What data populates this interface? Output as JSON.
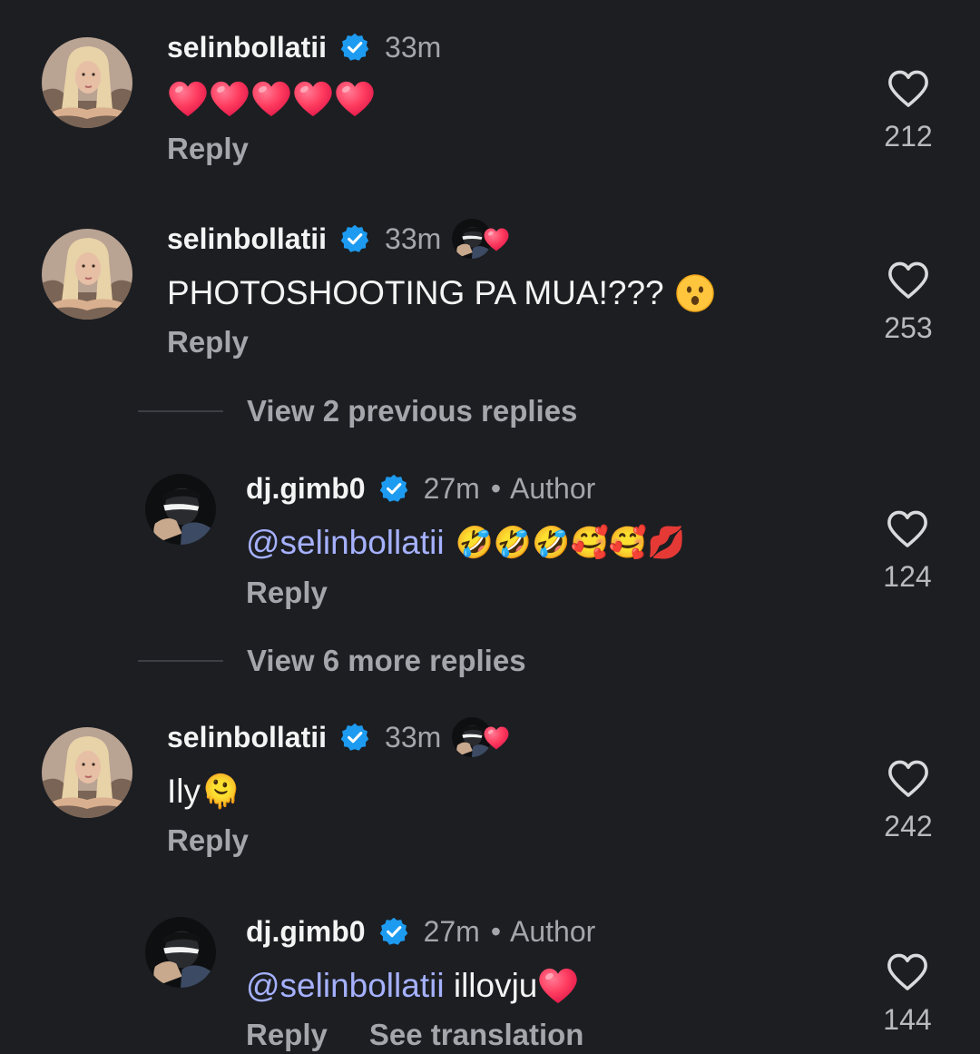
{
  "comments": [
    {
      "username": "selinbollatii",
      "time": "33m",
      "text": "",
      "emoji_hearts": 5,
      "reply_label": "Reply",
      "likes": "212",
      "liked_by_author": false
    },
    {
      "username": "selinbollatii",
      "time": "33m",
      "text": "PHOTOSHOOTING PA MUA!???",
      "trailing_emoji": "hushed-face",
      "reply_label": "Reply",
      "likes": "253",
      "liked_by_author": true
    },
    {
      "username": "dj.gimb0",
      "time": "27m",
      "author_label": "Author",
      "mention": "@selinbollatii",
      "emojis": "🤣🤣🤣🥰🥰💋",
      "reply_label": "Reply",
      "likes": "124"
    },
    {
      "username": "selinbollatii",
      "time": "33m",
      "text": "Ily",
      "emojis": "🫠",
      "reply_label": "Reply",
      "likes": "242",
      "liked_by_author": true
    },
    {
      "username": "dj.gimb0",
      "time": "27m",
      "author_label": "Author",
      "mention": "@selinbollatii",
      "text": " illovju",
      "reply_label": "Reply",
      "see_translation": "See translation",
      "likes": "144"
    }
  ],
  "view_previous": "View 2 previous replies",
  "view_more": "View 6 more replies",
  "icons": {
    "verified": "verified-badge-icon",
    "like": "heart-outline-icon",
    "liked_by_creator": "creator-heart-icon"
  },
  "colors": {
    "background": "#1c1e22",
    "verified": "#1d9bf0",
    "mention": "#a6b1ff",
    "heart": "#ff2d55"
  }
}
